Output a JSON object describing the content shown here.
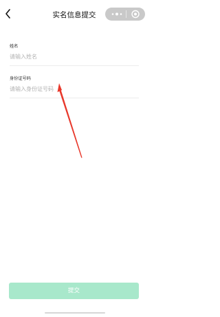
{
  "nav": {
    "title": "实名信息提交"
  },
  "form": {
    "name_label": "姓名",
    "name_placeholder": "请输入姓名",
    "name_value": "",
    "id_label": "身份证号码",
    "id_placeholder": "请输入身份证号码",
    "id_value": ""
  },
  "submit": {
    "label": "提交",
    "color": "#a8e8cb"
  },
  "colors": {
    "arrow": "#e8382b",
    "capsule": "#c9c9c9"
  },
  "icons": [
    "back-arrow-icon",
    "more-dots-icon",
    "close-target-icon"
  ]
}
